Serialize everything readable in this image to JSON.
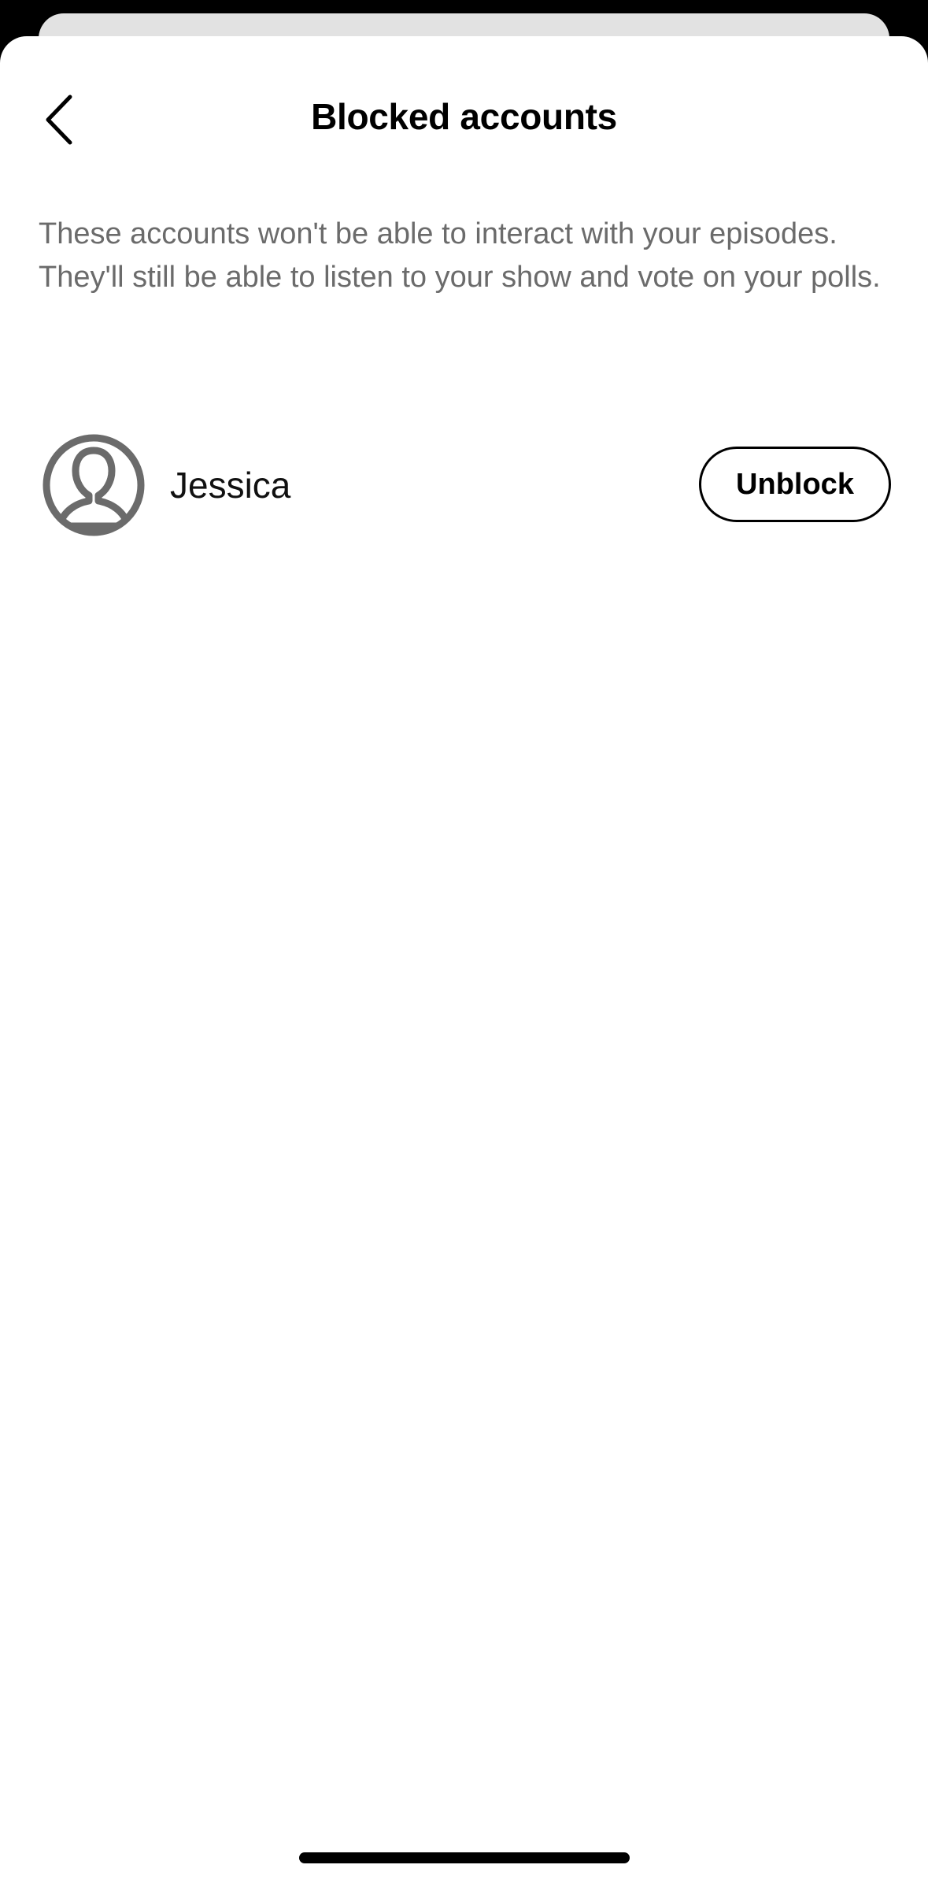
{
  "header": {
    "title": "Blocked accounts",
    "back_icon": "chevron-left-icon"
  },
  "description": "These accounts won't be able to interact with your episodes. They'll still be able to listen to your show and vote on your polls.",
  "blocked_accounts": [
    {
      "name": "Jessica",
      "avatar_icon": "user-avatar-icon",
      "action_label": "Unblock"
    }
  ],
  "colors": {
    "background": "#ffffff",
    "text_primary": "#000000",
    "text_secondary": "#6b6b6b",
    "avatar_gray": "#6b6b6b"
  }
}
